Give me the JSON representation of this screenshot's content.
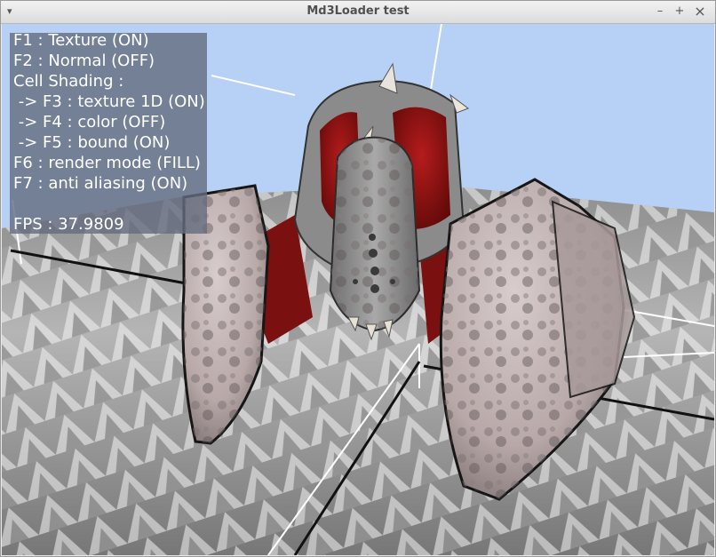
{
  "window": {
    "title": "Md3Loader test"
  },
  "controls": {
    "menu": "▾",
    "minimize": "–",
    "maximize": "+",
    "close": "×"
  },
  "hud": {
    "f1": "F1 : Texture (ON)",
    "f2": "F2 : Normal (OFF)",
    "cell_shading": "Cell Shading :",
    "f3": " -> F3 : texture 1D (ON)",
    "f4": " -> F4 : color (OFF)",
    "f5": " -> F5 : bound (ON)",
    "f6": "F6 : render mode (FILL)",
    "f7": "F7 : anti aliasing (ON)",
    "fps": "FPS : 37.9809"
  },
  "colors": {
    "sky": "#b6d1f5",
    "overlay": "#646c7e",
    "hud_text": "#ffffff",
    "armor_red": "#8e1414"
  }
}
